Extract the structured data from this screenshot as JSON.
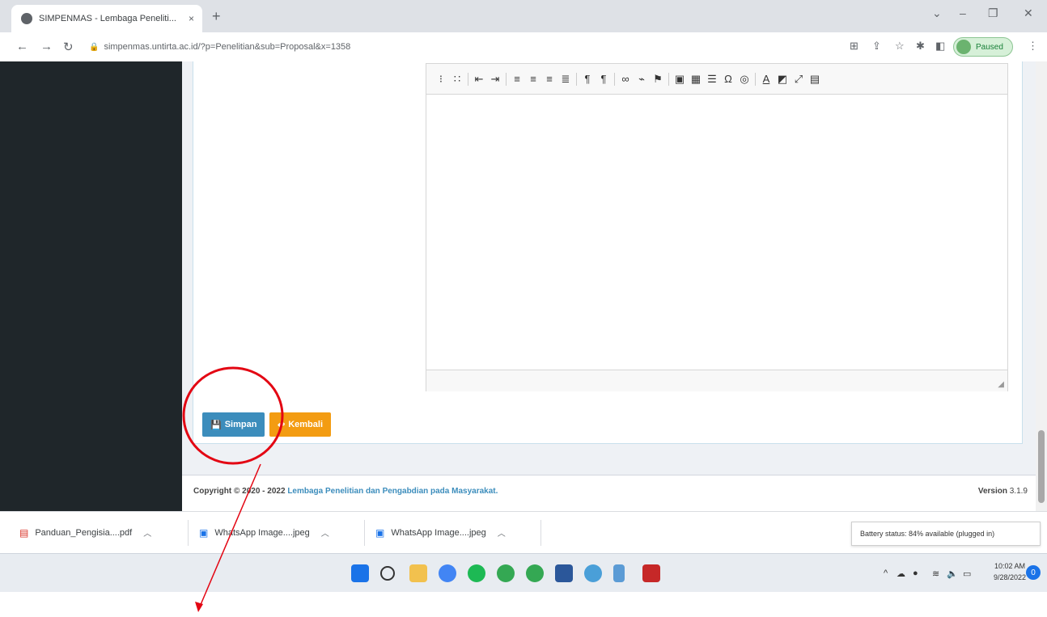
{
  "browser": {
    "tab_title": "SIMPENMAS - Lembaga Peneliti...",
    "tab_close": "×",
    "new_tab": "+",
    "url": "simpenmas.untirta.ac.id/?p=Penelitian&sub=Proposal&x=1358",
    "profile_status": "Paused"
  },
  "editor": {
    "toolbar_icons": [
      "numbered-list-icon",
      "bulleted-list-icon",
      "outdent-icon",
      "indent-icon",
      "align-left-icon",
      "align-center-icon",
      "align-right-icon",
      "justify-icon",
      "ltr-icon",
      "rtl-icon",
      "link-icon",
      "unlink-icon",
      "anchor-icon",
      "image-icon",
      "table-icon",
      "horizontal-line-icon",
      "special-char-icon",
      "iframe-icon",
      "text-color-icon",
      "bg-color-icon",
      "maximize-icon",
      "show-blocks-icon"
    ],
    "body_text": ""
  },
  "actions": {
    "save_label": "Simpan",
    "back_label": "Kembali"
  },
  "footer": {
    "copyright_prefix": "Copyright © 2020 - 2022",
    "org_name": "Lembaga Penelitian dan Pengabdian pada Masyarakat.",
    "version_label": "Version",
    "version_value": "3.1.9"
  },
  "downloads": [
    {
      "name": "Panduan_Pengisia....pdf"
    },
    {
      "name": "WhatsApp Image....jpeg"
    },
    {
      "name": "WhatsApp Image....jpeg"
    }
  ],
  "battery_tooltip": "Battery status: 84% available (plugged in)",
  "clock": {
    "time": "10:02 AM",
    "date": "9/28/2022"
  },
  "notification_count": "0",
  "colors": {
    "sidebar": "#1f262a",
    "primary_button": "#3c8dbc",
    "warning_button": "#f39c12",
    "annotation": "#e30613"
  }
}
